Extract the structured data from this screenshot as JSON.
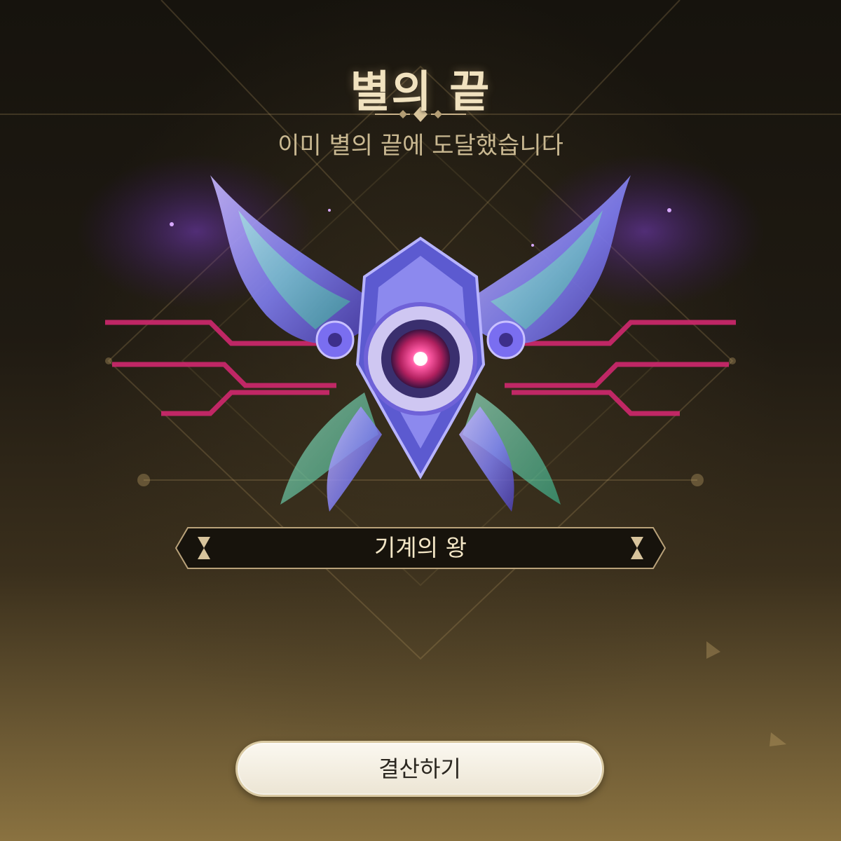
{
  "header": {
    "title": "별의 끝",
    "subtitle": "이미 별의 끝에 도달했습니다"
  },
  "rank": {
    "name": "기계의 왕"
  },
  "actions": {
    "settle_label": "결산하기"
  },
  "colors": {
    "gold_text": "#f1e2bf",
    "subtitle_text": "#c9b891",
    "emblem_core": "#ff3f8e",
    "emblem_wing": "#9aa0f5",
    "emblem_glow": "#6ff0c0"
  },
  "icons": {
    "emblem": "mechanical-wing-emblem",
    "banner_ornament": "hourglass-ornament"
  }
}
